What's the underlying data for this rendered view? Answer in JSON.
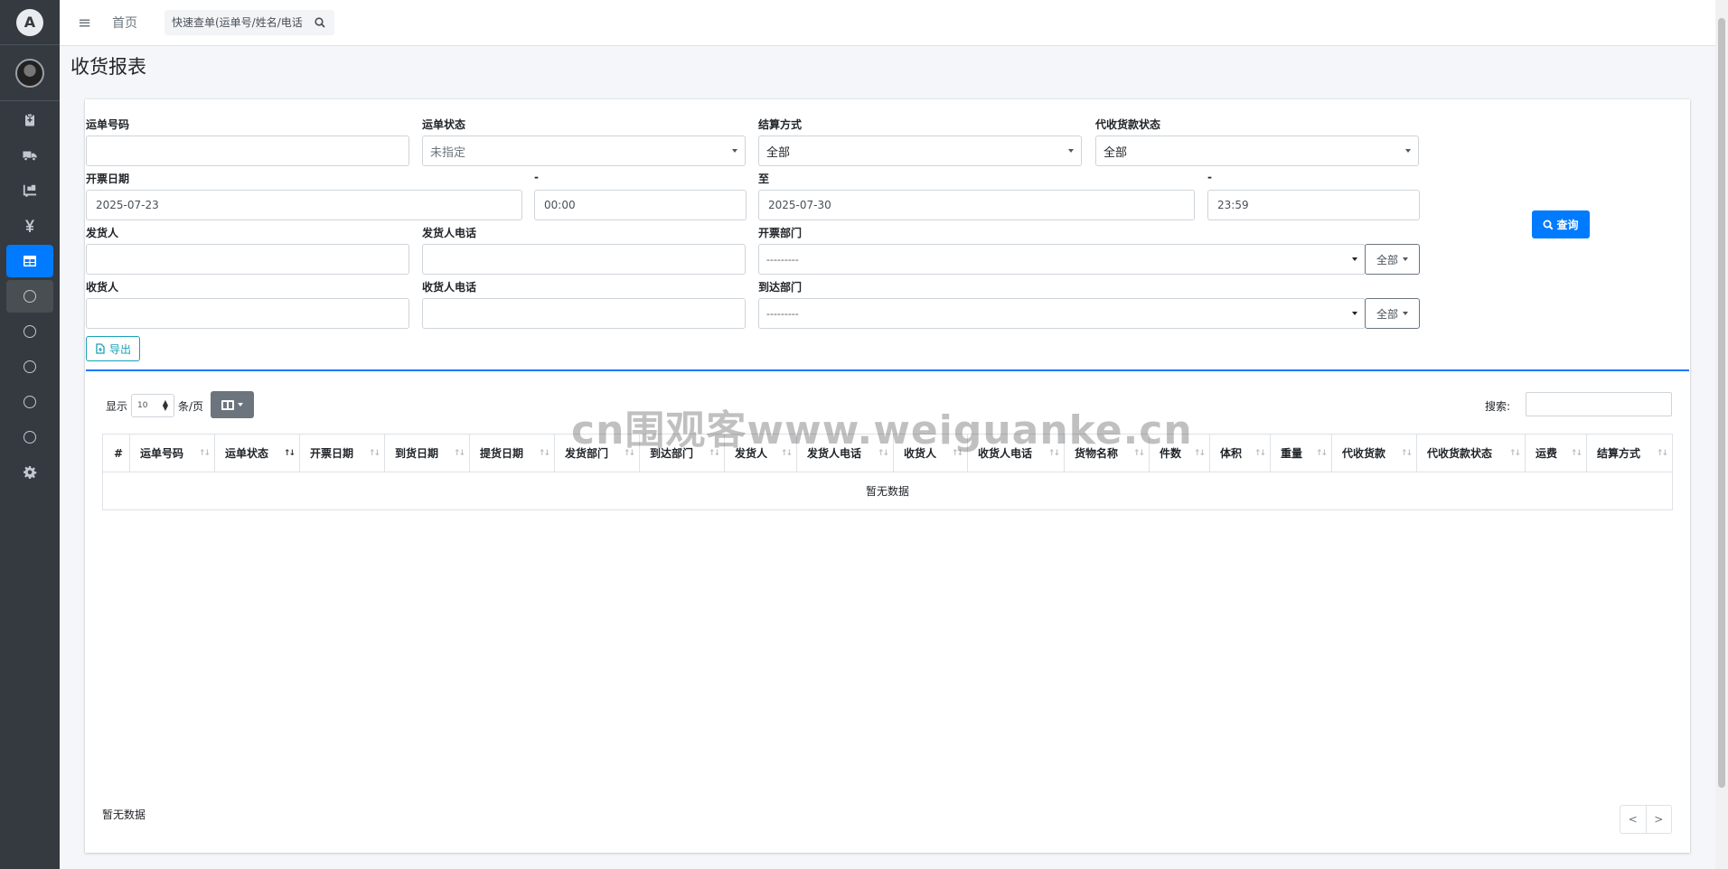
{
  "sidebar": {
    "logo_letter": "A",
    "items": [
      "clipboard-icon",
      "truck-icon",
      "dolly-icon",
      "yen-icon",
      "table-icon",
      "circle-icon",
      "circle-icon",
      "circle-icon",
      "circle-icon",
      "circle-icon",
      "gear-icon"
    ]
  },
  "topbar": {
    "home": "首页",
    "search_placeholder": "快速查单(运单号/姓名/电话"
  },
  "page": {
    "title": "收货报表"
  },
  "form": {
    "waybill_no": {
      "label": "运单号码",
      "value": ""
    },
    "waybill_status": {
      "label": "运单状态",
      "value": "未指定"
    },
    "settle_method": {
      "label": "结算方式",
      "value": "全部"
    },
    "cod_status": {
      "label": "代收货款状态",
      "value": "全部"
    },
    "invoice_date": {
      "label": "开票日期",
      "value": "2025-07-23"
    },
    "dash1": "-",
    "time_from": "00:00",
    "to_label": "至",
    "date_to": "2025-07-30",
    "dash2": "-",
    "time_to": "23:59",
    "shipper": {
      "label": "发货人",
      "value": ""
    },
    "shipper_phone": {
      "label": "发货人电话",
      "value": ""
    },
    "invoice_dept": {
      "label": "开票部门",
      "value": "---------",
      "btn": "全部"
    },
    "consignee": {
      "label": "收货人",
      "value": ""
    },
    "consignee_phone": {
      "label": "收货人电话",
      "value": ""
    },
    "arrival_dept": {
      "label": "到达部门",
      "value": "---------",
      "btn": "全部"
    },
    "query_btn": "查询",
    "export_btn": "导出"
  },
  "table": {
    "show": "显示",
    "page_size": "10",
    "per_page": "条/页",
    "search_label": "搜索:",
    "columns": [
      "#",
      "运单号码",
      "运单状态",
      "开票日期",
      "到货日期",
      "提货日期",
      "发货部门",
      "到达部门",
      "发货人",
      "发货人电话",
      "收货人",
      "收货人电话",
      "货物名称",
      "件数",
      "体积",
      "重量",
      "代收货款",
      "代收货款状态",
      "运费",
      "结算方式"
    ],
    "empty_text": "暂无数据",
    "footer_text": "暂无数据",
    "prev": "<",
    "next": ">"
  },
  "watermark": "cn围观客www.weiguanke.cn"
}
